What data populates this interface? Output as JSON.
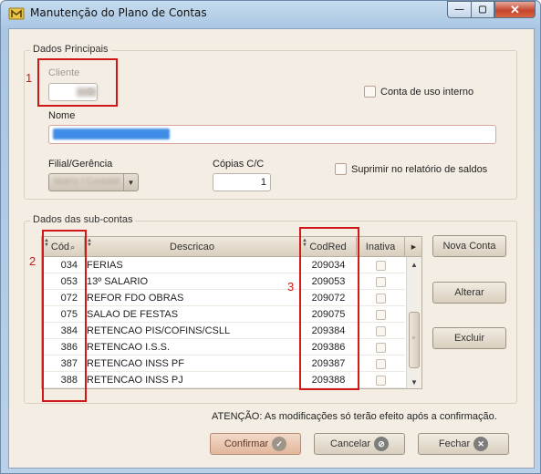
{
  "window": {
    "title": "Manutenção do Plano de Contas",
    "min_glyph": "—",
    "max_glyph": "▢",
    "close_glyph": "✕",
    "app_icon": "folder-m-icon"
  },
  "dados_principais": {
    "group_label": "Dados Principais",
    "cliente_label": "Cliente",
    "cliente_value": "9",
    "conta_uso_interno_label": "Conta de uso interno",
    "nome_label": "Nome",
    "filial_label": "Filial/Gerência",
    "filial_value": "Matriz / Contabil",
    "copias_label": "Cópias C/C",
    "copias_value": "1",
    "suprimir_label": "Suprimir no relatório de saldos"
  },
  "sub_contas": {
    "group_label": "Dados das sub-contas",
    "columns": {
      "cod": "Cód",
      "descricao": "Descricao",
      "codred": "CodRed",
      "inativa": "Inativa"
    },
    "rows": [
      {
        "cod": "034",
        "descricao": "FERIAS",
        "codred": "209034"
      },
      {
        "cod": "053",
        "descricao": "13º SALARIO",
        "codred": "209053"
      },
      {
        "cod": "072",
        "descricao": "REFOR FDO OBRAS",
        "codred": "209072"
      },
      {
        "cod": "075",
        "descricao": "SALAO DE FESTAS",
        "codred": "209075"
      },
      {
        "cod": "384",
        "descricao": "RETENCAO PIS/COFINS/CSLL",
        "codred": "209384"
      },
      {
        "cod": "386",
        "descricao": "RETENCAO I.S.S.",
        "codred": "209386"
      },
      {
        "cod": "387",
        "descricao": "RETENCAO INSS PF",
        "codred": "209387"
      },
      {
        "cod": "388",
        "descricao": "RETENCAO INSS PJ",
        "codred": "209388"
      }
    ],
    "nova_conta": "Nova Conta",
    "alterar": "Alterar",
    "excluir": "Excluir"
  },
  "footer": {
    "message": "ATENÇÃO: As modificações só terão efeito após a confirmação.",
    "confirmar": "Confirmar",
    "cancelar": "Cancelar",
    "fechar": "Fechar"
  },
  "annotations": {
    "one": "1",
    "two": "2",
    "three": "3",
    "color": "#d01818"
  },
  "colors": {
    "client_bg": "#f3ede3",
    "title_bar": "#b9d1e9",
    "selection": "#3f8de6"
  }
}
